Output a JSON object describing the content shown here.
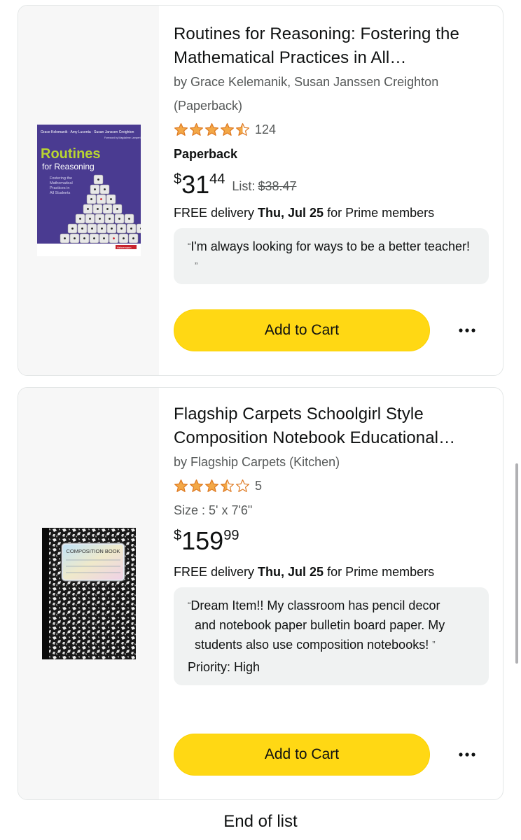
{
  "items": [
    {
      "title_line1": "Routines for Reasoning: Fostering the",
      "title_line2": "Mathematical Practices in All…",
      "byline_line1": "by Grace Kelemanik, Susan Janssen Creighton",
      "byline_line2": "(Paperback)",
      "rating": 4.5,
      "rating_count": "124",
      "format": "Paperback",
      "price_symbol": "$",
      "price_whole": "31",
      "price_fraction": "44",
      "list_label": "List:",
      "list_price": "$38.47",
      "delivery_prefix": "FREE delivery ",
      "delivery_date": "Thu, Jul 25",
      "delivery_suffix": " for Prime members",
      "note_text": "I'm always looking for ways to be a better teacher!",
      "add_to_cart": "Add to Cart",
      "cover": {
        "authors": "Grace Kelemanik · Amy Lucenta · Susan Janssen Creighton",
        "foreword": "Foreword by Magdalene Lampert",
        "title_1": "Routines",
        "title_2": "for Reasoning",
        "subtitle_1": "Fostering the",
        "subtitle_2": "Mathematical",
        "subtitle_3": "Practices in",
        "subtitle_4": "All Students",
        "publisher": "Heinemann"
      }
    },
    {
      "title_line1": "Flagship Carpets Schoolgirl Style",
      "title_line2": "Composition Notebook Educational…",
      "byline_line1": "by Flagship Carpets (Kitchen)",
      "rating": 3.5,
      "rating_count": "5",
      "size": "Size : 5' x 7'6\"",
      "price_symbol": "$",
      "price_whole": "159",
      "price_fraction": "99",
      "delivery_prefix": "FREE delivery ",
      "delivery_date": "Thu, Jul 25",
      "delivery_suffix": " for Prime members",
      "note_text": "Dream Item!! My classroom has pencil decor and notebook paper bulletin board paper. My students also use composition notebooks!",
      "priority": "Priority: High",
      "add_to_cart": "Add to Cart",
      "cover": {
        "label": "COMPOSITION BOOK"
      }
    }
  ],
  "end_of_list": "End of list",
  "colors": {
    "cart_button": "#ffd814",
    "star": "#f3a847",
    "thumb_bg": "#f7f7f7",
    "note_bg": "#f0f2f2"
  },
  "icons": {
    "more": "more-horizontal-icon",
    "star": "star-icon"
  }
}
